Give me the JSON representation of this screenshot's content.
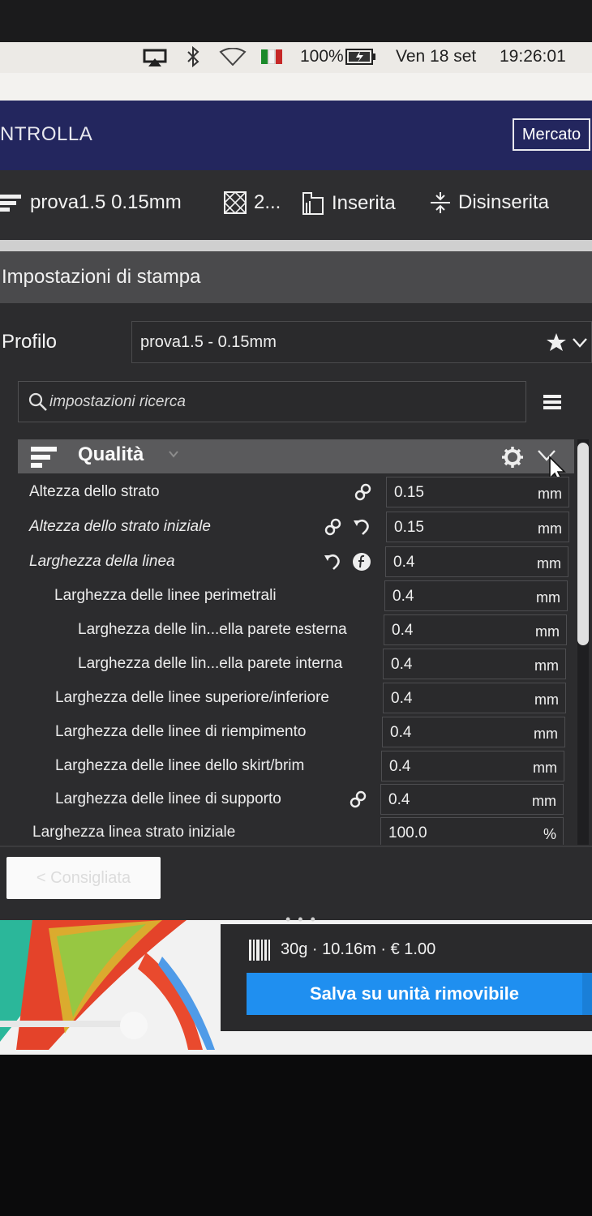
{
  "menubar": {
    "battery": "100%",
    "date": "Ven 18 set",
    "time": "19:26:01",
    "icons": [
      "airplay-icon",
      "bluetooth-icon",
      "wifi-icon",
      "flag-it-icon",
      "battery-icon"
    ]
  },
  "header": {
    "title": "NTROLLA",
    "market_label": "Mercato"
  },
  "toolbar": {
    "profile": "prova1.5 0.15mm",
    "infill": "2...",
    "support": "Inserita",
    "adhesion": "Disinserita"
  },
  "panel": {
    "title": "Impostazioni di stampa",
    "profile_label": "Profilo",
    "profile_value": "prova1.5 - 0.15mm",
    "search_placeholder": "impostazioni ricerca",
    "category": "Qualità",
    "settings": [
      {
        "label": "Altezza dello strato",
        "value": "0.15",
        "unit": "mm"
      },
      {
        "label": "Altezza dello strato iniziale",
        "value": "0.15",
        "unit": "mm"
      },
      {
        "label": "Larghezza della linea",
        "value": "0.4",
        "unit": "mm"
      },
      {
        "label": "Larghezza delle linee perimetrali",
        "value": "0.4",
        "unit": "mm"
      },
      {
        "label": "Larghezza delle lin...ella parete esterna",
        "value": "0.4",
        "unit": "mm"
      },
      {
        "label": "Larghezza delle lin...ella parete interna",
        "value": "0.4",
        "unit": "mm"
      },
      {
        "label": "Larghezza delle linee superiore/inferiore",
        "value": "0.4",
        "unit": "mm"
      },
      {
        "label": "Larghezza delle linee di riempimento",
        "value": "0.4",
        "unit": "mm"
      },
      {
        "label": "Larghezza delle linee dello skirt/brim",
        "value": "0.4",
        "unit": "mm"
      },
      {
        "label": "Larghezza delle linee di supporto",
        "value": "0.4",
        "unit": "mm"
      },
      {
        "label": "Larghezza linea strato iniziale",
        "value": "100.0",
        "unit": "%"
      }
    ],
    "recommended_label": "< Consigliata"
  },
  "output": {
    "estimate": "30g · 10.16m · € 1.00",
    "save_label": "Salva su unità rimovibile"
  },
  "colors": {
    "header": "#23265e",
    "accent": "#1f8ff0",
    "panel": "#2c2c2e"
  }
}
